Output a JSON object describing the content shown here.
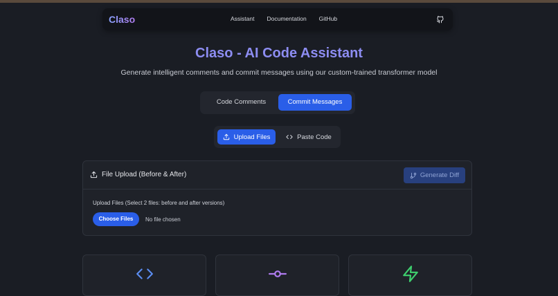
{
  "brand": "Claso",
  "nav": {
    "links": [
      "Assistant",
      "Documentation",
      "GitHub"
    ]
  },
  "hero": {
    "title": "Claso - AI Code Assistant",
    "subtitle": "Generate intelligent comments and commit messages using our custom-trained transformer model"
  },
  "mode_tabs": [
    {
      "label": "Code Comments",
      "active": false
    },
    {
      "label": "Commit Messages",
      "active": true
    }
  ],
  "input_tabs": [
    {
      "label": "Upload Files",
      "icon": "upload-icon",
      "active": true
    },
    {
      "label": "Paste Code",
      "icon": "code-icon",
      "active": false
    }
  ],
  "upload_card": {
    "title": "File Upload (Before & After)",
    "generate_label": "Generate Diff",
    "field_label": "Upload Files (Select 2 files: before and after versions)",
    "choose_label": "Choose Files",
    "no_file_text": "No file chosen"
  },
  "features": [
    {
      "icon": "code-icon",
      "color": "#5b8df0"
    },
    {
      "icon": "git-commit-icon",
      "color": "#b07cf0"
    },
    {
      "icon": "zap-icon",
      "color": "#3ecf6e"
    }
  ],
  "colors": {
    "accent": "#2a5ee8",
    "background": "#1a1d24",
    "title": "#8d8df2"
  }
}
